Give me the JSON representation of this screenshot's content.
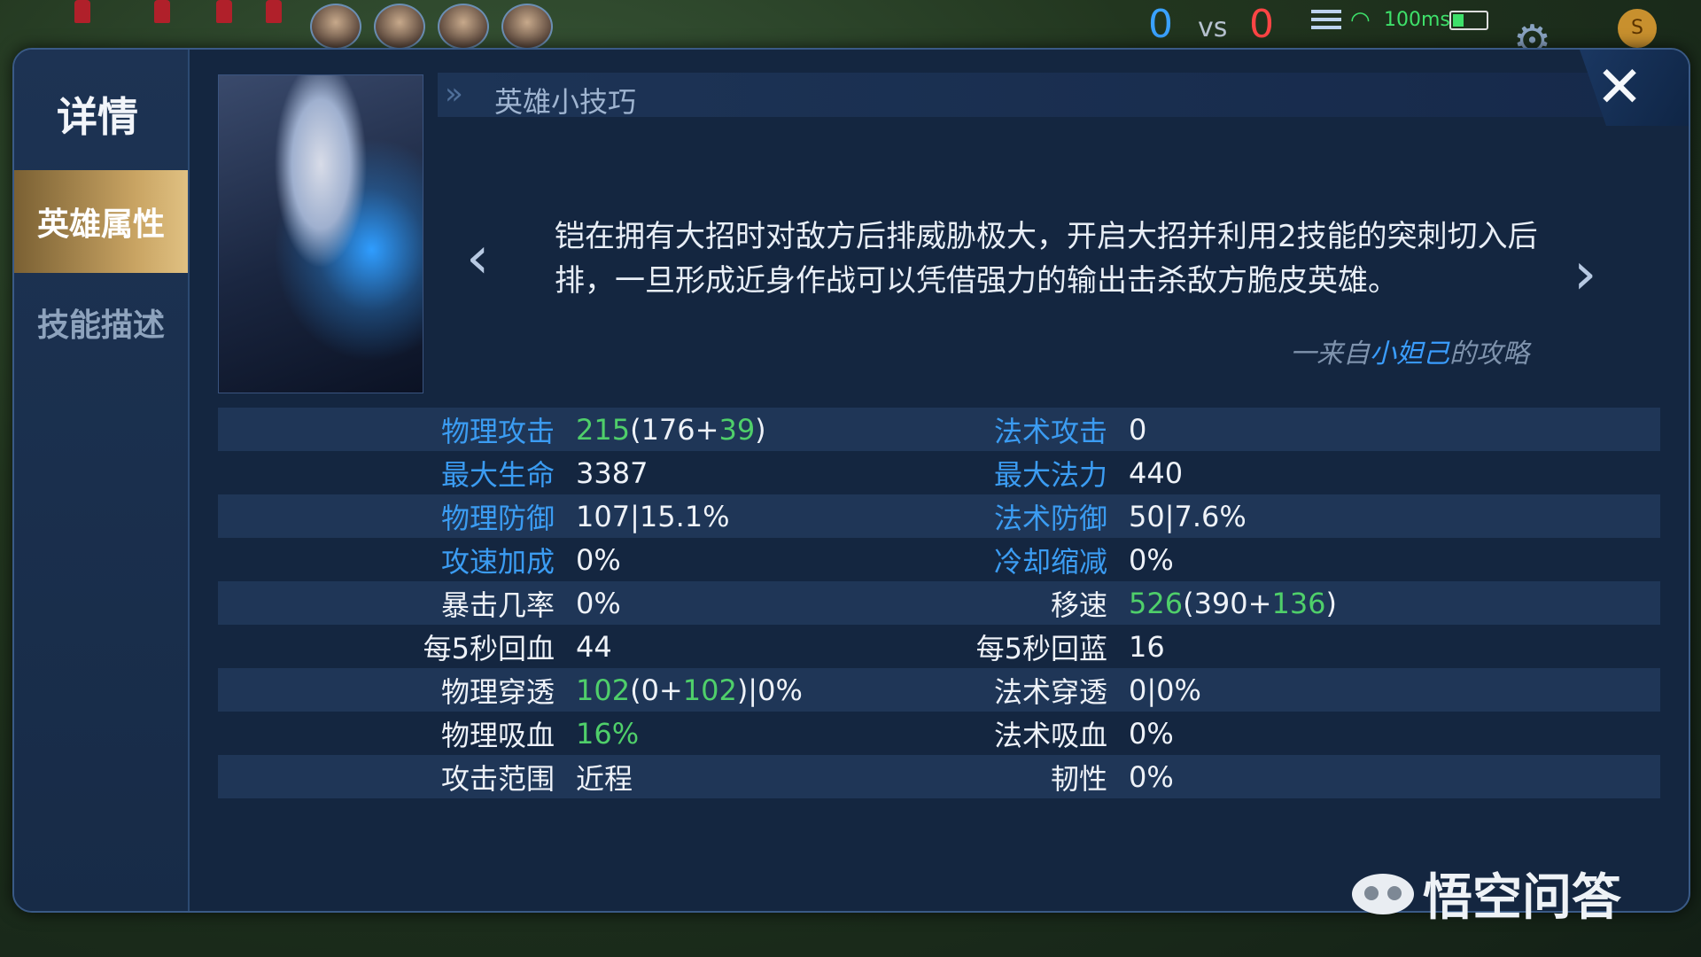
{
  "hud": {
    "score_blue": "0",
    "vs": "vs",
    "score_red": "0",
    "ping": "100ms",
    "coin": "S"
  },
  "sidebar": {
    "title": "详情",
    "tabs": [
      {
        "label": "英雄属性",
        "active": true
      },
      {
        "label": "技能描述",
        "active": false
      }
    ]
  },
  "tips": {
    "title": "英雄小技巧",
    "text": "铠在拥有大招时对敌方后排威胁极大，开启大招并利用2技能的突刺切入后排，一旦形成近身作战可以凭借强力的输出击杀敌方脆皮英雄。",
    "source_prefix": "一来自",
    "source_author": "小妲己",
    "source_suffix": "的攻略"
  },
  "stats": [
    {
      "left_label": "物理攻击",
      "left_parts": [
        [
          "215",
          "green"
        ],
        [
          "(176+",
          "white"
        ],
        [
          "39",
          "green"
        ],
        [
          ")",
          "white"
        ]
      ],
      "right_label": "法术攻击",
      "right_parts": [
        [
          "0",
          "white"
        ]
      ],
      "left_label_color": "blue",
      "right_label_color": "blue"
    },
    {
      "left_label": "最大生命",
      "left_parts": [
        [
          "3387",
          "white"
        ]
      ],
      "right_label": "最大法力",
      "right_parts": [
        [
          "440",
          "white"
        ]
      ],
      "left_label_color": "blue",
      "right_label_color": "blue"
    },
    {
      "left_label": "物理防御",
      "left_parts": [
        [
          "107|15.1%",
          "white"
        ]
      ],
      "right_label": "法术防御",
      "right_parts": [
        [
          "50|7.6%",
          "white"
        ]
      ],
      "left_label_color": "blue",
      "right_label_color": "blue"
    },
    {
      "left_label": "攻速加成",
      "left_parts": [
        [
          "0%",
          "white"
        ]
      ],
      "right_label": "冷却缩减",
      "right_parts": [
        [
          "0%",
          "white"
        ]
      ],
      "left_label_color": "blue",
      "right_label_color": "blue"
    },
    {
      "left_label": "暴击几率",
      "left_parts": [
        [
          "0%",
          "white"
        ]
      ],
      "right_label": "移速",
      "right_parts": [
        [
          "526",
          "green"
        ],
        [
          "(390+",
          "white"
        ],
        [
          "136",
          "green"
        ],
        [
          ")",
          "white"
        ]
      ],
      "left_label_color": "white",
      "right_label_color": "white"
    },
    {
      "left_label": "每5秒回血",
      "left_parts": [
        [
          "44",
          "white"
        ]
      ],
      "right_label": "每5秒回蓝",
      "right_parts": [
        [
          "16",
          "white"
        ]
      ],
      "left_label_color": "white",
      "right_label_color": "white"
    },
    {
      "left_label": "物理穿透",
      "left_parts": [
        [
          "102",
          "green"
        ],
        [
          "(0+",
          "white"
        ],
        [
          "102",
          "green"
        ],
        [
          ")|0%",
          "white"
        ]
      ],
      "right_label": "法术穿透",
      "right_parts": [
        [
          "0|0%",
          "white"
        ]
      ],
      "left_label_color": "white",
      "right_label_color": "white"
    },
    {
      "left_label": "物理吸血",
      "left_parts": [
        [
          "16%",
          "green"
        ]
      ],
      "right_label": "法术吸血",
      "right_parts": [
        [
          "0%",
          "white"
        ]
      ],
      "left_label_color": "white",
      "right_label_color": "white"
    },
    {
      "left_label": "攻击范围",
      "left_parts": [
        [
          "近程",
          "white"
        ]
      ],
      "right_label": "韧性",
      "right_parts": [
        [
          "0%",
          "white"
        ]
      ],
      "left_label_color": "white",
      "right_label_color": "white"
    }
  ],
  "watermark": {
    "text": "悟空问答"
  },
  "colors": {
    "accent_blue": "#3b9cf2",
    "accent_green": "#4fcf6a",
    "tab_gold": "#c9a463"
  }
}
